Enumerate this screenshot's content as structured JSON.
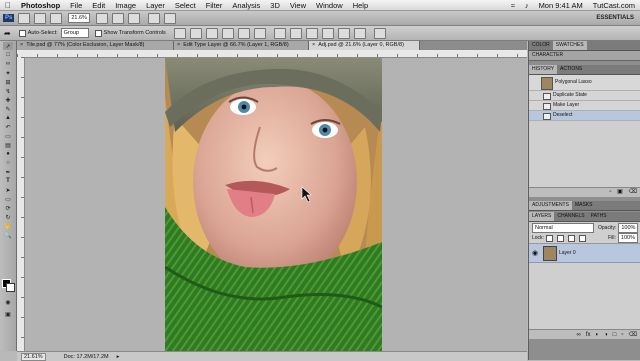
{
  "menubar": {
    "app": "Photoshop",
    "items": [
      "File",
      "Edit",
      "Image",
      "Layer",
      "Select",
      "Filter",
      "Analysis",
      "3D",
      "View",
      "Window",
      "Help"
    ],
    "clock": "Mon 9:41 AM",
    "site": "TutCast.com"
  },
  "appbar": {
    "zoom": "21.6%",
    "workspace": "ESSENTIALS"
  },
  "options": {
    "auto_select_label": "Auto-Select:",
    "auto_select_value": "Group",
    "transform_label": "Show Transform Controls"
  },
  "tabs": [
    {
      "label": "Tile.psd @ 77% (Color Exclusion, Layer Mask/8)",
      "active": false
    },
    {
      "label": "Edit Type Layer @ 66.7% (Layer 1, RGB/8)",
      "active": false
    },
    {
      "label": "Adj.psd @ 21.6% (Layer 0, RGB/8)",
      "active": true
    }
  ],
  "status": {
    "zoom": "21.61%",
    "doc": "Doc: 17.2M/17.2M"
  },
  "panels": {
    "top_tabs": [
      "Color",
      "Swatches"
    ],
    "character": "Character",
    "history_tabs": [
      "History",
      "Actions"
    ],
    "history_snapshot": "Polygonal Lasso",
    "history_steps": [
      "Duplicate State",
      "Make Layer",
      "Deselect"
    ],
    "adjust_tabs": [
      "Adjustments",
      "Masks"
    ],
    "layer_tabs": [
      "Layers",
      "Channels",
      "Paths"
    ],
    "blend_mode": "Normal",
    "opacity_label": "Opacity:",
    "opacity_value": "100%",
    "lock_label": "Lock:",
    "fill_label": "Fill:",
    "fill_value": "100%",
    "layer_name": "Layer 0"
  },
  "colors": {
    "accent": "#b8c7dd",
    "scarf": "#2f7a24",
    "hat": "#7c7e6a"
  }
}
